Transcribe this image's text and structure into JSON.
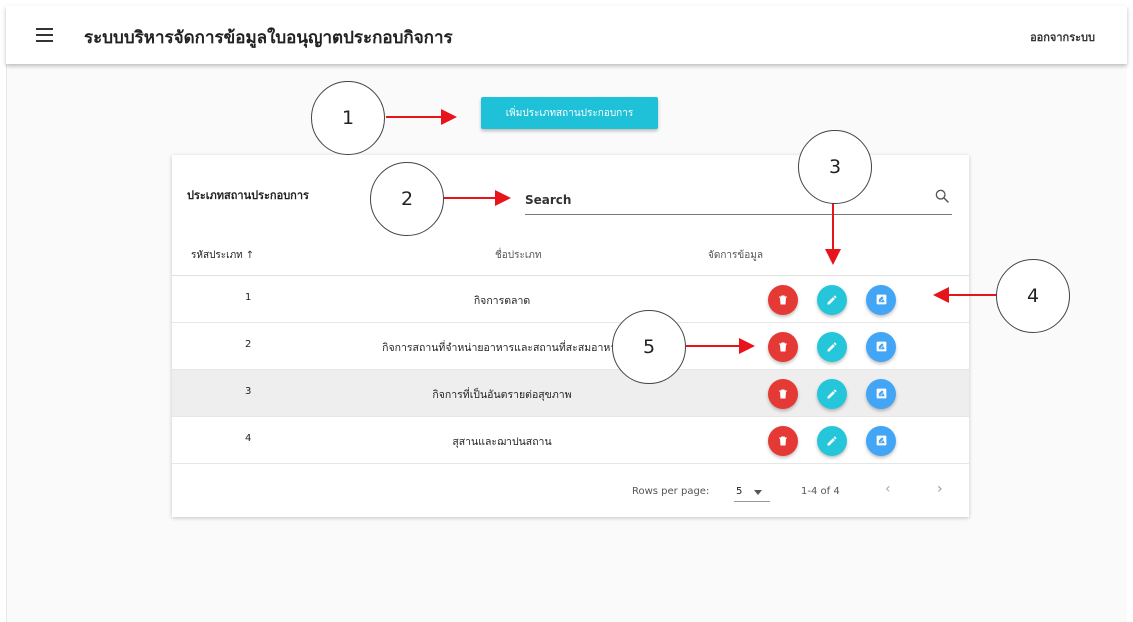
{
  "app": {
    "title": "ระบบบริหารจัดการข้อมูลใบอนุญาตประกอบกิจการ",
    "logout_label": "ออกจากระบบ"
  },
  "add_button_label": "เพิ่มประเภทสถานประกอบการ",
  "card": {
    "title": "ประเภทสถานประกอบการ",
    "search_placeholder": "Search"
  },
  "table": {
    "headers": {
      "code": "รหัสประเภท",
      "name": "ชื่อประเภท",
      "manage": "จัดการข้อมูล"
    },
    "rows": [
      {
        "code": "1",
        "name": "กิจการตลาด"
      },
      {
        "code": "2",
        "name": "กิจการสถานที่จำหน่ายอาหารและสถานที่สะสมอาหาร"
      },
      {
        "code": "3",
        "name": "กิจการที่เป็นอันตรายต่อสุขภาพ"
      },
      {
        "code": "4",
        "name": "สุสานและฌาปนสถาน"
      }
    ]
  },
  "pagination": {
    "rows_per_page_label": "Rows per page:",
    "rows_per_page_value": "5",
    "range_label": "1-4 of 4"
  },
  "callouts": [
    "1",
    "2",
    "3",
    "4",
    "5"
  ],
  "colors": {
    "add_button": "#1fc1d9",
    "delete": "#e53935",
    "edit": "#26c6da",
    "manage": "#42a5f5",
    "arrow": "#e8141c"
  },
  "icons": {
    "menu": "hamburger-menu-icon",
    "search": "search-icon",
    "delete": "trash-icon",
    "edit": "pencil-icon",
    "manage": "image-edit-icon",
    "sort": "arrow-up-icon"
  }
}
